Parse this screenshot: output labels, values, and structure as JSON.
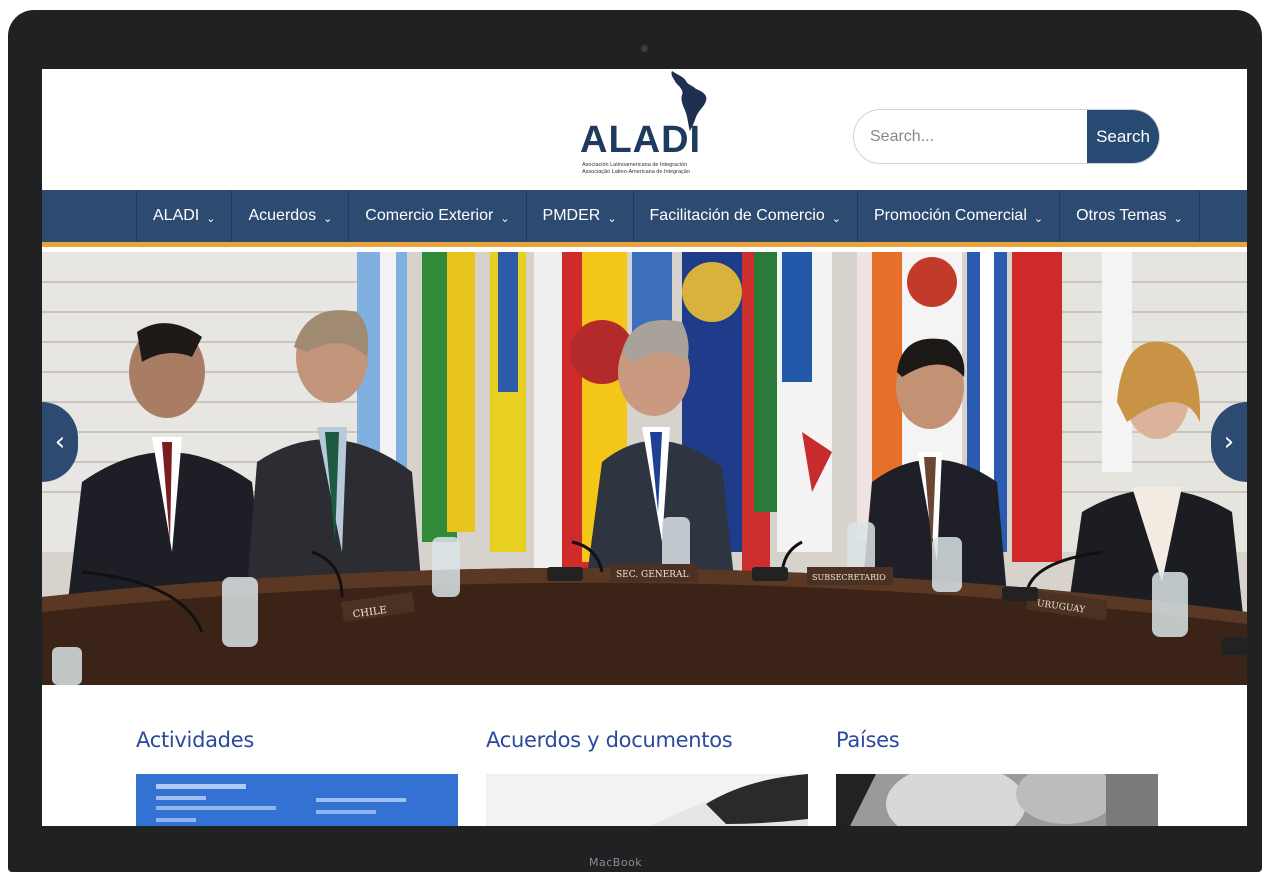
{
  "device": {
    "brand_label": "MacBook"
  },
  "logo": {
    "name": "ALADI",
    "subtitle_es": "Asociación Latinoamericana de Integración",
    "subtitle_pt": "Associação Latino-Americana de Integração"
  },
  "search": {
    "placeholder": "Search...",
    "button_label": "Search"
  },
  "nav": {
    "items": [
      {
        "label": "ALADI"
      },
      {
        "label": "Acuerdos"
      },
      {
        "label": "Comercio Exterior"
      },
      {
        "label": "PMDER"
      },
      {
        "label": "Facilitación de Comercio"
      },
      {
        "label": "Promoción Comercial"
      },
      {
        "label": "Otros Temas"
      }
    ]
  },
  "hero": {
    "nameplates": [
      "CHILE",
      "SEC. GENERAL",
      "SUBSECRETARIO",
      "URUGUAY"
    ],
    "arrow_left": "‹",
    "arrow_right": "›"
  },
  "sections": [
    {
      "title": "Actividades"
    },
    {
      "title": "Acuerdos y documentos"
    },
    {
      "title": "Países"
    }
  ],
  "colors": {
    "nav_bg": "#2d4a70",
    "accent": "#e8a33a",
    "heading": "#2b4a9f",
    "search_button": "#274a73"
  }
}
